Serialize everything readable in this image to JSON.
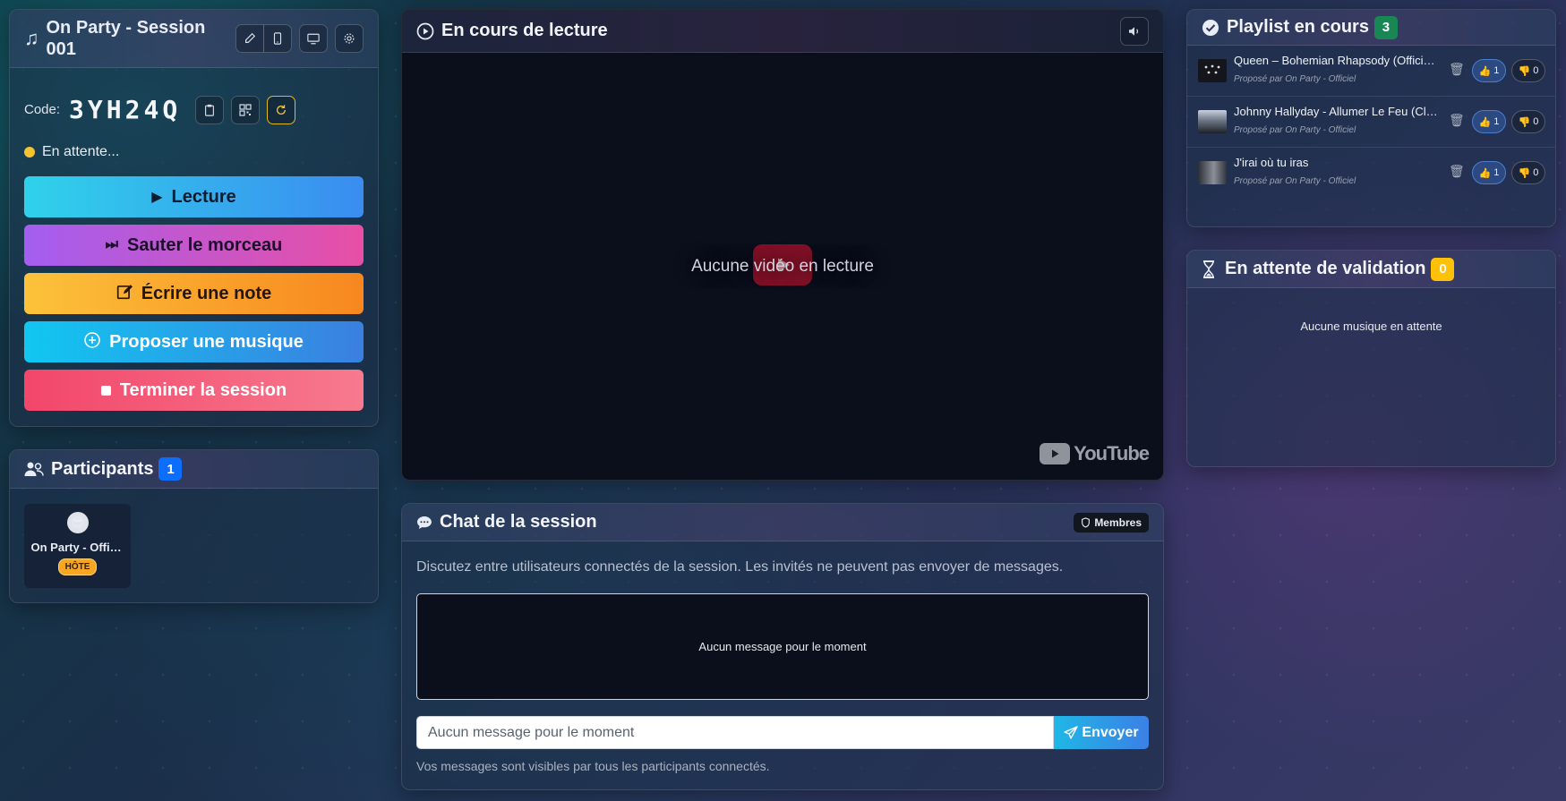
{
  "session": {
    "title": "On Party - Session 001",
    "code_label": "Code:",
    "code": "3YH24Q",
    "status": "En attente..."
  },
  "actions": {
    "play": "Lecture",
    "skip": "Sauter le morceau",
    "note": "Écrire une note",
    "propose": "Proposer une musique",
    "end": "Terminer la session"
  },
  "participants": {
    "title": "Participants",
    "count": "1",
    "items": [
      {
        "name": "On Party - Officiel",
        "role": "HÔTE",
        "avatar": "😎"
      }
    ]
  },
  "player": {
    "title": "En cours de lecture",
    "empty": "Aucune vidéo en lecture",
    "logo": "YouTube"
  },
  "chat": {
    "title": "Chat de la session",
    "members_badge": "Membres",
    "description": "Discutez entre utilisateurs connectés de la session. Les invités ne peuvent pas envoyer de messages.",
    "empty": "Aucun message pour le moment",
    "input_value": "Aucun message pour le moment",
    "send": "Envoyer",
    "note": "Vos messages sont visibles par tous les participants connectés."
  },
  "playlist": {
    "title": "Playlist en cours",
    "count": "3",
    "items": [
      {
        "title": "Queen – Bohemian Rhapsody (Official Video Remastered)",
        "by": "Proposé par On Party - Officiel",
        "up": "1",
        "down": "0"
      },
      {
        "title": "Johnny Hallyday - Allumer Le Feu (Clip officiel)",
        "by": "Proposé par On Party - Officiel",
        "up": "1",
        "down": "0"
      },
      {
        "title": "J'irai où tu iras",
        "by": "Proposé par On Party - Officiel",
        "up": "1",
        "down": "0"
      }
    ]
  },
  "pending": {
    "title": "En attente de validation",
    "count": "0",
    "empty": "Aucune musique en attente"
  },
  "colors": {
    "accent_yellow": "#f4c430",
    "playlist_badge": "#198754",
    "pending_badge": "#ffc107",
    "participants_badge": "#0d6efd"
  }
}
